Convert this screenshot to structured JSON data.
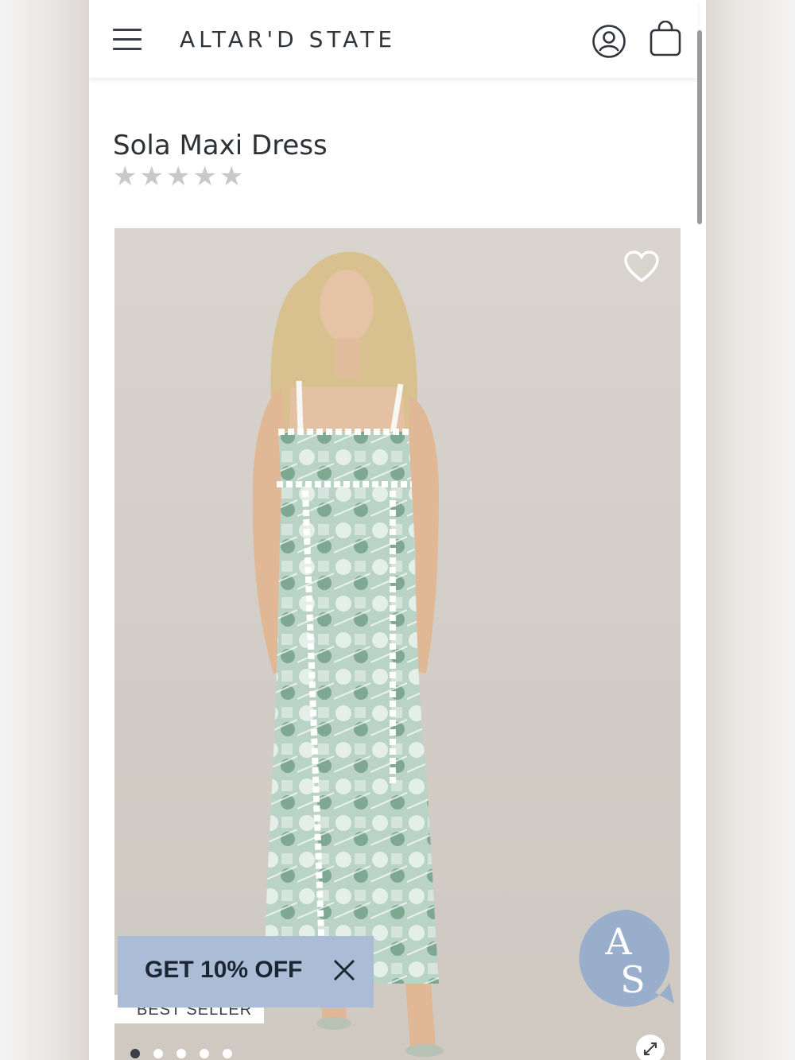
{
  "header": {
    "logo": "ALTAR'D STATE"
  },
  "product": {
    "title": "Sola Maxi Dress",
    "rating": {
      "stars_filled": 0,
      "stars_total": 5
    }
  },
  "gallery": {
    "badge": "BEST SELLER",
    "image_count": 5,
    "active_index": 0
  },
  "promo": {
    "label": "GET 10% OFF"
  },
  "chat_badge": {
    "monogram_top": "A",
    "monogram_bottom": "S"
  },
  "icons": {
    "menu": "hamburger-icon",
    "account": "account-icon",
    "bag": "shopping-bag-icon",
    "wishlist": "heart-icon",
    "close": "close-icon",
    "expand": "expand-icon"
  },
  "colors": {
    "promo_bg": "#abbdd6",
    "chat_badge_bg": "#98aecb",
    "text_dark": "#2e3136"
  }
}
